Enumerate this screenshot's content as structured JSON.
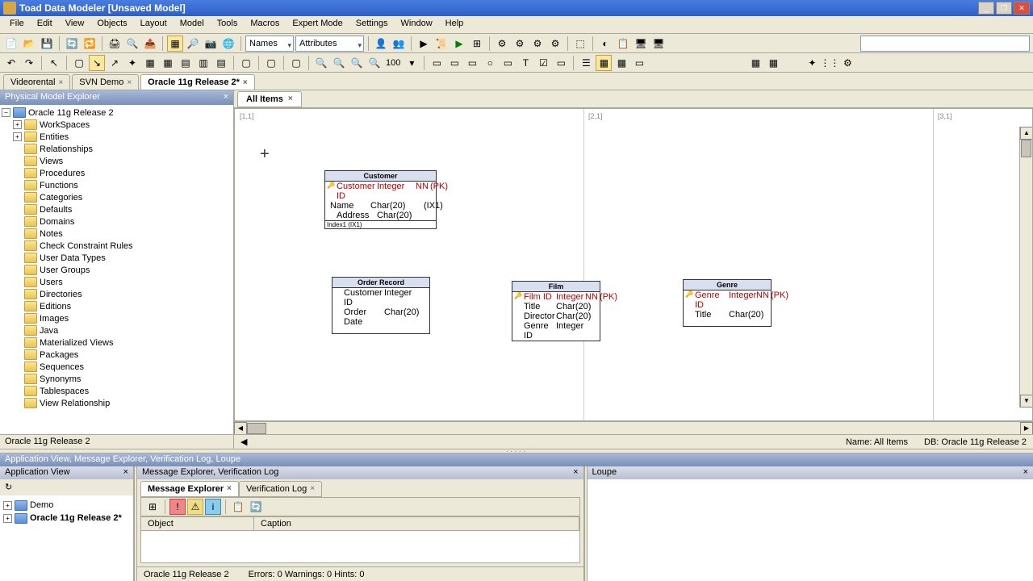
{
  "title": "Toad Data Modeler  [Unsaved Model]",
  "menu": [
    "File",
    "Edit",
    "View",
    "Objects",
    "Layout",
    "Model",
    "Tools",
    "Macros",
    "Expert Mode",
    "Settings",
    "Window",
    "Help"
  ],
  "toolbar1": {
    "combo1": "Names",
    "combo2": "Attributes"
  },
  "toolbar2": {
    "zoom": "100"
  },
  "model_tabs": [
    {
      "label": "Videorental",
      "active": false
    },
    {
      "label": "SVN Demo",
      "active": false
    },
    {
      "label": "Oracle 11g Release 2*",
      "active": true
    }
  ],
  "tree": {
    "header": "Physical Model Explorer",
    "root": "Oracle 11g Release 2",
    "items": [
      "WorkSpaces",
      "Entities",
      "Relationships",
      "Views",
      "Procedures",
      "Functions",
      "Categories",
      "Defaults",
      "Domains",
      "Notes",
      "Check Constraint Rules",
      "User Data Types",
      "User Groups",
      "Users",
      "Directories",
      "Editions",
      "Images",
      "Java",
      "Materialized Views",
      "Packages",
      "Sequences",
      "Synonyms",
      "Tablespaces",
      "View Relationship"
    ],
    "footer": "Oracle 11g Release 2"
  },
  "canvas": {
    "tab": "All Items",
    "pages": {
      "p11": "[1,1]",
      "p21": "[2,1]",
      "p31": "[3,1]"
    },
    "status_name": "Name: All Items",
    "status_db": "DB: Oracle 11g Release 2"
  },
  "entities": {
    "customer": {
      "title": "Customer",
      "rows": [
        {
          "key": true,
          "name": "Customer ID",
          "type": "Integer",
          "nn": "NN",
          "pk": "(PK)"
        },
        {
          "key": false,
          "name": "Name",
          "type": "Char(20)",
          "nn": "",
          "pk": "(IX1)"
        },
        {
          "key": false,
          "name": "Address",
          "type": "Char(20)",
          "nn": "",
          "pk": ""
        }
      ],
      "keys": "Index1 (IX1)"
    },
    "order": {
      "title": "Order Record",
      "rows": [
        {
          "key": false,
          "name": "Customer ID",
          "type": "Integer",
          "nn": "",
          "pk": ""
        },
        {
          "key": false,
          "name": "Order Date",
          "type": "Char(20)",
          "nn": "",
          "pk": ""
        }
      ]
    },
    "film": {
      "title": "Film",
      "rows": [
        {
          "key": true,
          "name": "Film ID",
          "type": "Integer",
          "nn": "NN",
          "pk": "(PK)"
        },
        {
          "key": false,
          "name": "Title",
          "type": "Char(20)",
          "nn": "",
          "pk": ""
        },
        {
          "key": false,
          "name": "Director",
          "type": "Char(20)",
          "nn": "",
          "pk": ""
        },
        {
          "key": false,
          "name": "Genre ID",
          "type": "Integer",
          "nn": "",
          "pk": ""
        }
      ]
    },
    "genre": {
      "title": "Genre",
      "rows": [
        {
          "key": true,
          "name": "Genre ID",
          "type": "Integer",
          "nn": "NN",
          "pk": "(PK)"
        },
        {
          "key": false,
          "name": "Title",
          "type": "Char(20)",
          "nn": "",
          "pk": ""
        }
      ]
    }
  },
  "bottom": {
    "combined_header": "Application View, Message Explorer, Verification Log, Loupe",
    "app_view": {
      "title": "Application View",
      "refresh": "↻",
      "items": [
        "Demo",
        "Oracle 11g Release 2*"
      ]
    },
    "msg": {
      "title": "Message Explorer, Verification Log",
      "tabs": [
        "Message Explorer",
        "Verification Log"
      ],
      "cols": [
        "Object",
        "Caption"
      ],
      "status_model": "Oracle 11g Release 2",
      "status_counts": "Errors: 0   Warnings: 0   Hints: 0"
    },
    "loupe": {
      "title": "Loupe"
    }
  }
}
